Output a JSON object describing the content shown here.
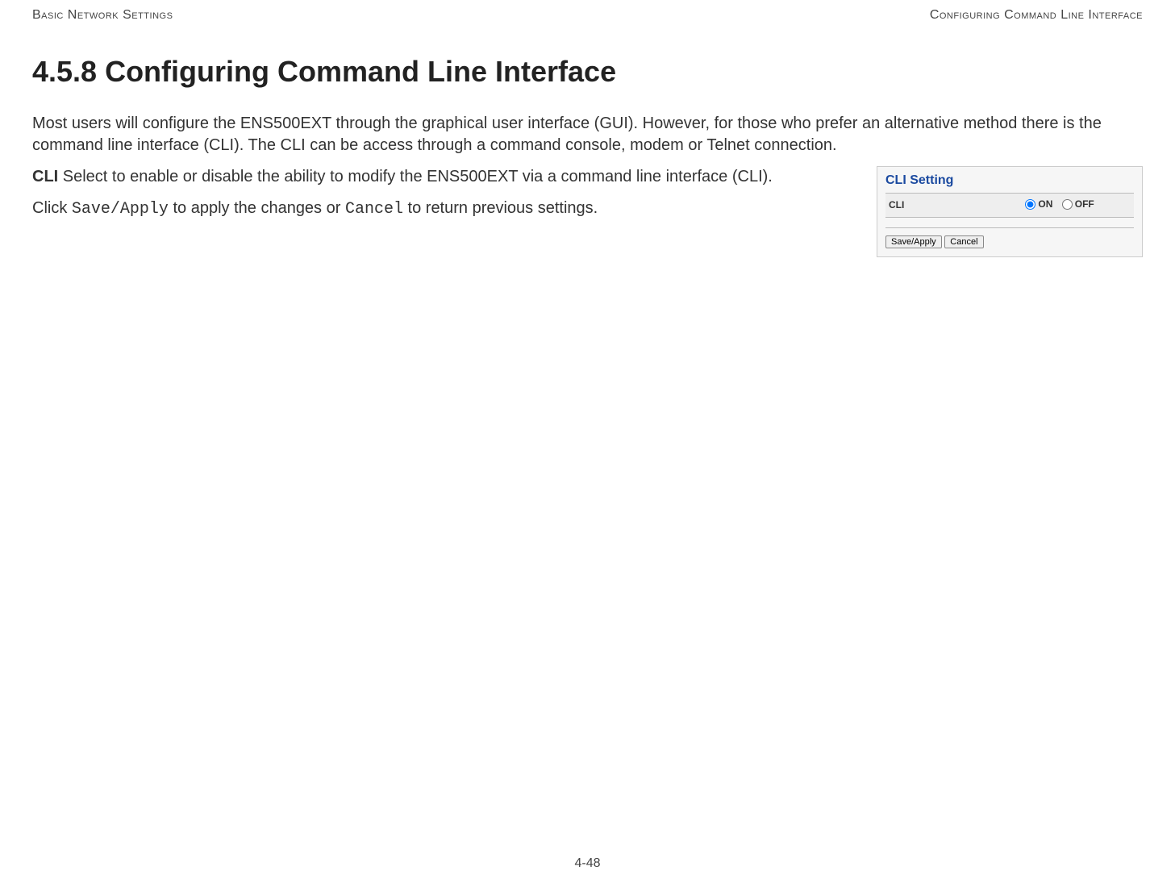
{
  "header": {
    "left": "Basic Network Settings",
    "right": "Configuring Command Line Interface"
  },
  "section": {
    "title": "4.5.8 Configuring Command Line Interface",
    "intro": "Most users will configure the ENS500EXT through the graphical user interface (GUI). However, for those who prefer an alternative method there is the command line interface (CLI).  The CLI can be access through a command console, modem or Telnet connection.",
    "cli_label": "CLI",
    "cli_desc": "  Select to enable or disable the ability to modify the ENS500EXT via a command line interface (CLI).",
    "click_prefix": "Click ",
    "save_apply_mono": "Save/Apply",
    "middle_text": " to apply the changes or ",
    "cancel_mono": "Cancel",
    "suffix_text": " to return previous settings."
  },
  "screenshot": {
    "title": "CLI Setting",
    "row_label": "CLI",
    "radio_on": "ON",
    "radio_off": "OFF",
    "btn_save": "Save/Apply",
    "btn_cancel": "Cancel"
  },
  "footer": {
    "page": "4-48"
  }
}
